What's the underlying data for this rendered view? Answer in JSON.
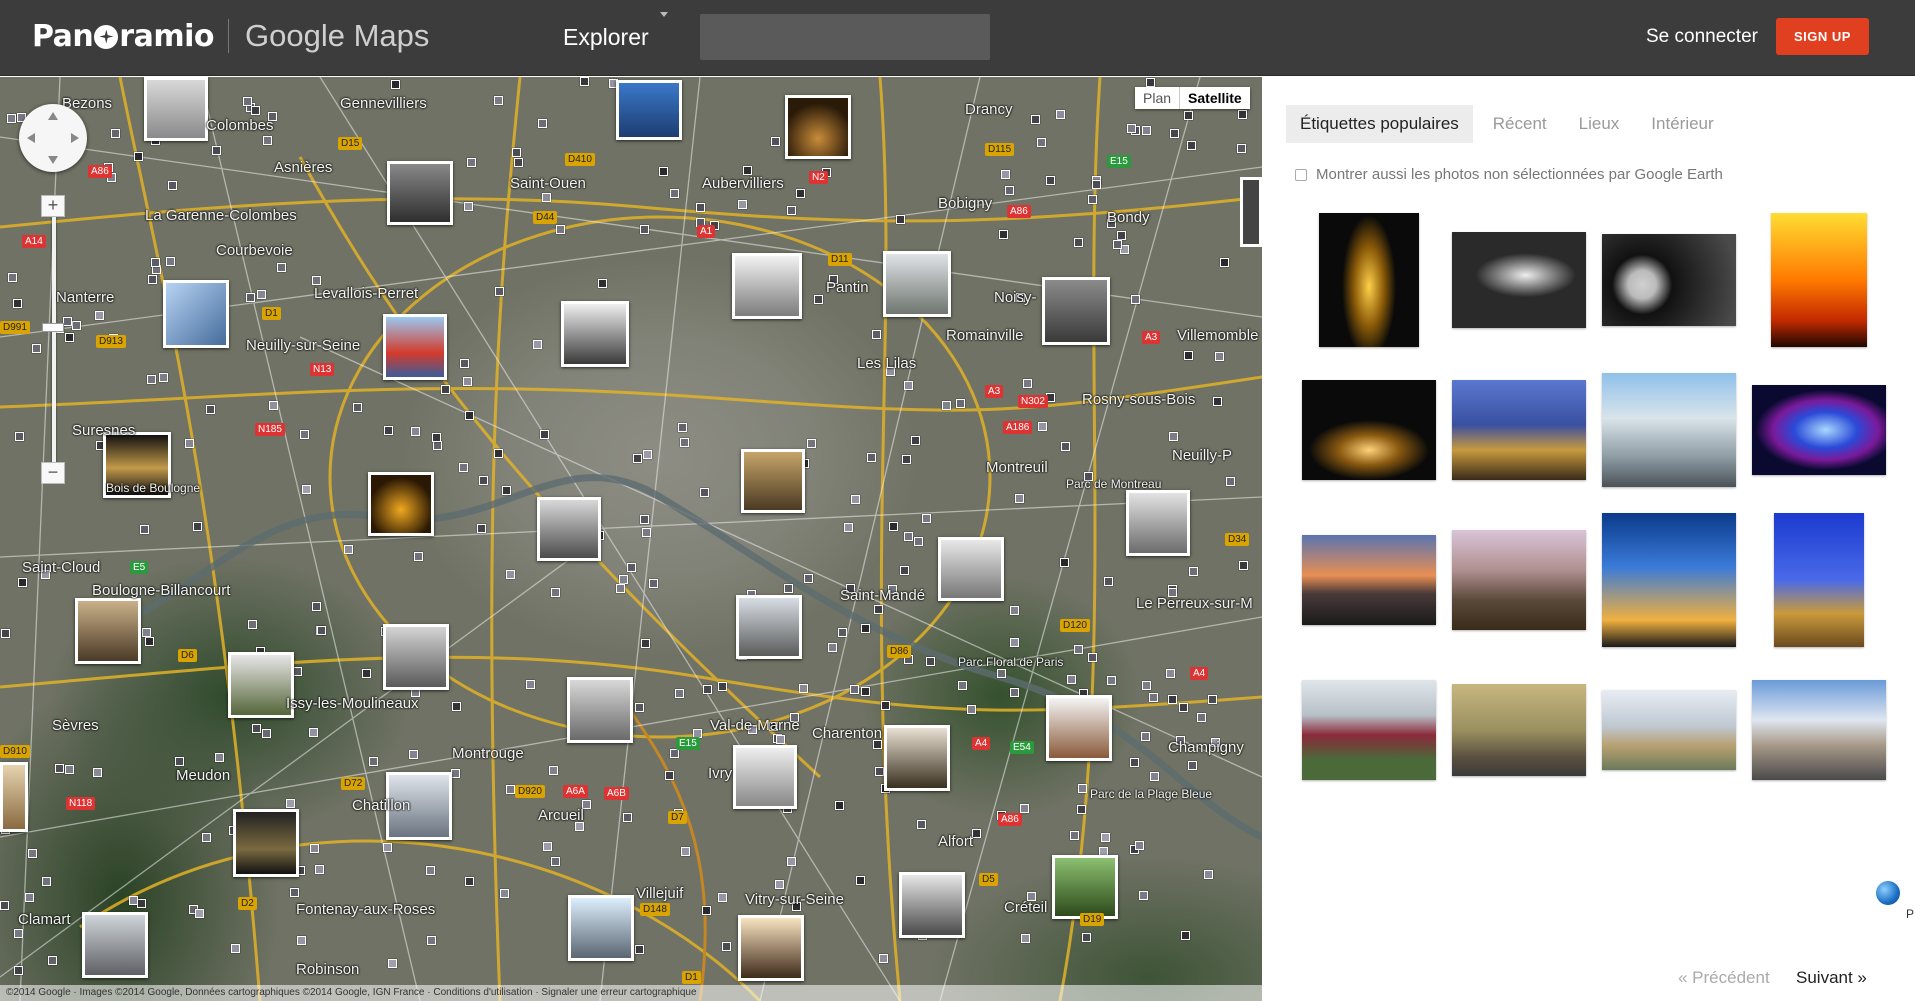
{
  "header": {
    "brand_panoramio": "Pan",
    "brand_panoramio_tail": "ramio",
    "brand_maps": "Google Maps",
    "explore_label": "Explorer",
    "search_value": "",
    "sign_in_label": "Se connecter",
    "sign_up_label": "SIGN UP"
  },
  "map": {
    "map_type_plan": "Plan",
    "map_type_satellite": "Satellite",
    "zoom_in": "+",
    "zoom_out": "−",
    "places": [
      "Bezons",
      "Colombes",
      "Asnières",
      "Gennevilliers",
      "Saint-Ouen",
      "Aubervilliers",
      "Drancy",
      "Bobigny",
      "Bondy",
      "La Garenne-Colombes",
      "Courbevoie",
      "Nanterre",
      "Levallois-Perret",
      "Neuilly-sur-Seine",
      "Pantin",
      "Noisy-",
      "Romainville",
      "Villemomble",
      "Les Lilas",
      "Rosny-sous-Bois",
      "Suresnes",
      "Montreuil",
      "Neuilly-P",
      "Saint-Cloud",
      "Boulogne-Billancourt",
      "Saint-Mandé",
      "Le Perreux-sur-M",
      "Sèvres",
      "Issy-les-Moulineaux",
      "Montrouge",
      "Val-de-Marne",
      "Charenton",
      "Champigny",
      "Ivry",
      "Arcueil",
      "Alfort",
      "Meudon",
      "Chatillon",
      "Fontenay-aux-Roses",
      "Villejuif",
      "Vitry-sur-Seine",
      "Créteil",
      "Clamart",
      "Robinson",
      "Parc Floral de Paris",
      "Bois de Boulogne",
      "Parc de Montreau",
      "Parc de la Plage Bleue"
    ],
    "attribution": "©2014 Google · Images ©2014 Google, Données cartographiques ©2014 Google, IGN France · Conditions d'utilisation · Signaler une erreur cartographique"
  },
  "panel": {
    "tabs": [
      {
        "label": "Étiquettes populaires",
        "active": true
      },
      {
        "label": "Récent",
        "active": false
      },
      {
        "label": "Lieux",
        "active": false
      },
      {
        "label": "Intérieur",
        "active": false
      }
    ],
    "earth_checkbox_label": "Montrer aussi les photos non sélectionnées par Google Earth",
    "earth_checkbox_checked": false,
    "prev_label": "« Précédent",
    "next_label": "Suivant »",
    "globe_letter": "P"
  },
  "colors": {
    "topbar": "#3c3c3c",
    "signup": "#e0401f",
    "panel_bg": "#ffffff",
    "active_tab_bg": "#ececec"
  }
}
